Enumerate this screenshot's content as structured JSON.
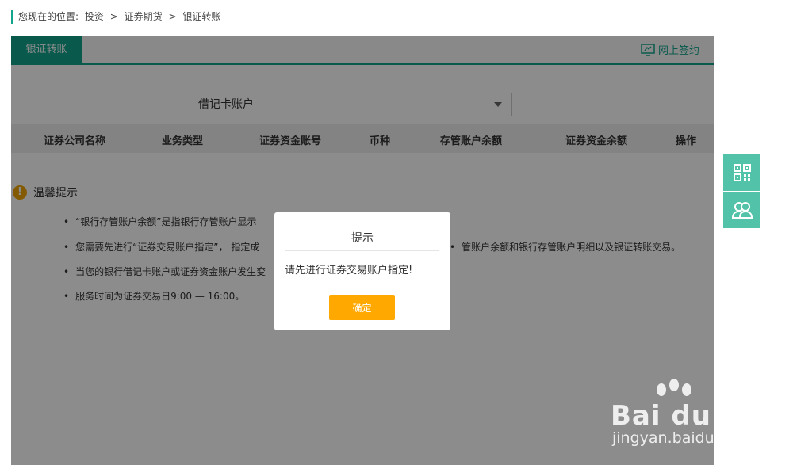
{
  "breadcrumb": {
    "prefix": "您现在的位置:",
    "items": [
      "投资",
      "证券期货",
      "银证转账"
    ],
    "separator": ">"
  },
  "tabs": {
    "active_label": "银证转账"
  },
  "sign_link": {
    "label": "网上签约",
    "icon": "monitor-sign-icon"
  },
  "form": {
    "debit_card_label": "借记卡账户",
    "debit_card_value": ""
  },
  "table": {
    "headers": [
      "证券公司名称",
      "业务类型",
      "证券资金账号",
      "币种",
      "存管账户余额",
      "证券资金余额",
      "操作"
    ]
  },
  "tips": {
    "title": "温馨提示",
    "items": [
      "“银行存管账户余额”是指银行存管账户显示",
      "您需要先进行“证券交易账户指定”， 指定成",
      "管账户余额和银行存管账户明细以及银证转账交易。",
      "当您的银行借记卡账户或证券资金账户发生变",
      "服务时间为证券交易日9:00 — 16:00。"
    ]
  },
  "modal": {
    "title": "提示",
    "message": "请先进行证券交易账户指定!",
    "confirm_label": "确定"
  },
  "side_widgets": [
    "qr-code-icon",
    "customer-service-icon"
  ],
  "watermark": {
    "main": "Bai du 经验",
    "sub": "jingyan.baidu.com"
  },
  "colors": {
    "brand": "#12a58c",
    "confirm": "#ffa800",
    "side": "#52c3a8",
    "warn": "#f0a500"
  }
}
